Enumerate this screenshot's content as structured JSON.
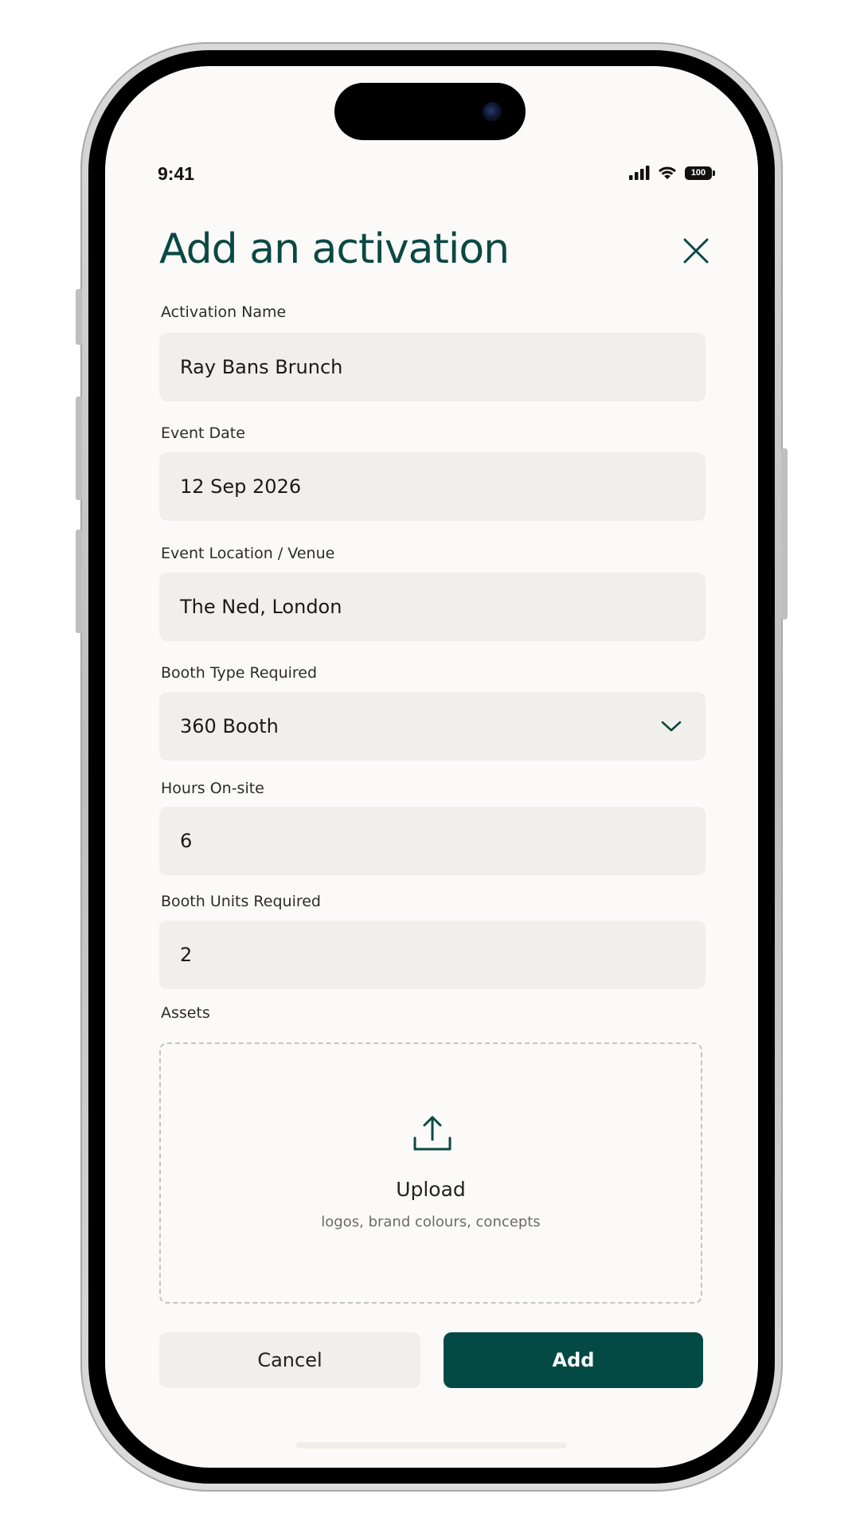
{
  "status_bar": {
    "time": "9:41",
    "battery": "100"
  },
  "header": {
    "title": "Add an activation",
    "close_icon": "close-icon"
  },
  "form": {
    "activation_name": {
      "label": "Activation Name",
      "value": "Ray Bans Brunch"
    },
    "event_date": {
      "label": "Event Date",
      "value": "12 Sep 2026"
    },
    "event_location": {
      "label": "Event Location / Venue",
      "value": "The Ned, London"
    },
    "booth_type": {
      "label": "Booth Type Required",
      "value": "360 Booth",
      "icon": "chevron-down-icon"
    },
    "hours_onsite": {
      "label": "Hours On-site",
      "value": "6"
    },
    "booth_units": {
      "label": "Booth Units Required",
      "value": "2"
    },
    "assets": {
      "label": "Assets",
      "upload_title": "Upload",
      "upload_hint": "logos, brand colours, concepts",
      "icon": "upload-icon"
    }
  },
  "actions": {
    "cancel_label": "Cancel",
    "add_label": "Add"
  },
  "colors": {
    "brand": "#034a44",
    "title": "#0b4943",
    "field_bg": "#f1efec",
    "screen_bg": "#fcfaf8"
  }
}
